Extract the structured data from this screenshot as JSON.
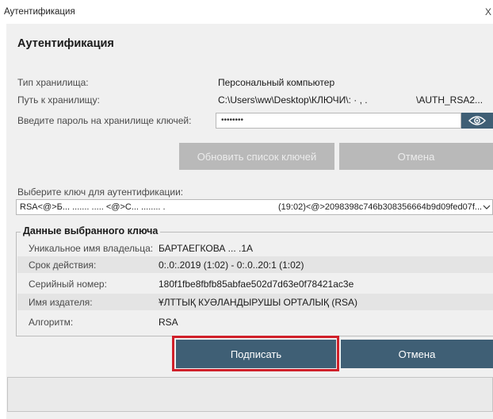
{
  "window": {
    "title": "Аутентификация",
    "close_glyph": "X"
  },
  "heading": "Аутентификация",
  "store": {
    "type_label": "Тип хранилища:",
    "type_value": "Персональный компьютер",
    "path_label": "Путь к хранилищу:",
    "path_value": "C:\\Users\\ww\\Desktop\\КЛЮЧИ\\: ·    ,  .",
    "path_tail": "\\AUTH_RSA2...",
    "password_label": "Введите пароль на хранилище ключей:",
    "password_value": "••••••••"
  },
  "buttons": {
    "refresh_keys": "Обновить список ключей",
    "cancel_top": "Отмена",
    "sign": "Подписать",
    "cancel_bottom": "Отмена"
  },
  "key_select": {
    "label": "Выберите ключ для аутентификации:",
    "value_left": "RSA<@>Б...  ....... ..... <@>С... ........  .",
    "value_right": "(19:02)<@>2098398c746b308356664b9d09fed07f..."
  },
  "details": {
    "legend": "Данные выбранного ключа",
    "rows": [
      {
        "label": "Уникальное имя владельца:",
        "value": "БАРТАЕГКОВА ...  .1А"
      },
      {
        "label": "Срок действия:",
        "value": "0:.0:.2019 (1:02) - 0:.0..20:1 (1:02)"
      },
      {
        "label": "Серийный номер:",
        "value": "180f1fbe8fbfb85abfae502d7d63e0f78421ac3e"
      },
      {
        "label": "Имя издателя:",
        "value": "ҰЛТТЫҚ КУӘЛАНДЫРУШЫ ОРТАЛЫҚ (RSA)"
      },
      {
        "label": "Алгоритм:",
        "value": "RSA"
      }
    ]
  },
  "status_text": "",
  "colors": {
    "accent": "#3f5f75",
    "disabled_button": "#b9b9b9",
    "highlight": "#d0202a"
  },
  "icons": {
    "show_password": "eye-icon",
    "dropdown": "chevron-down-icon",
    "close": "close-icon"
  }
}
